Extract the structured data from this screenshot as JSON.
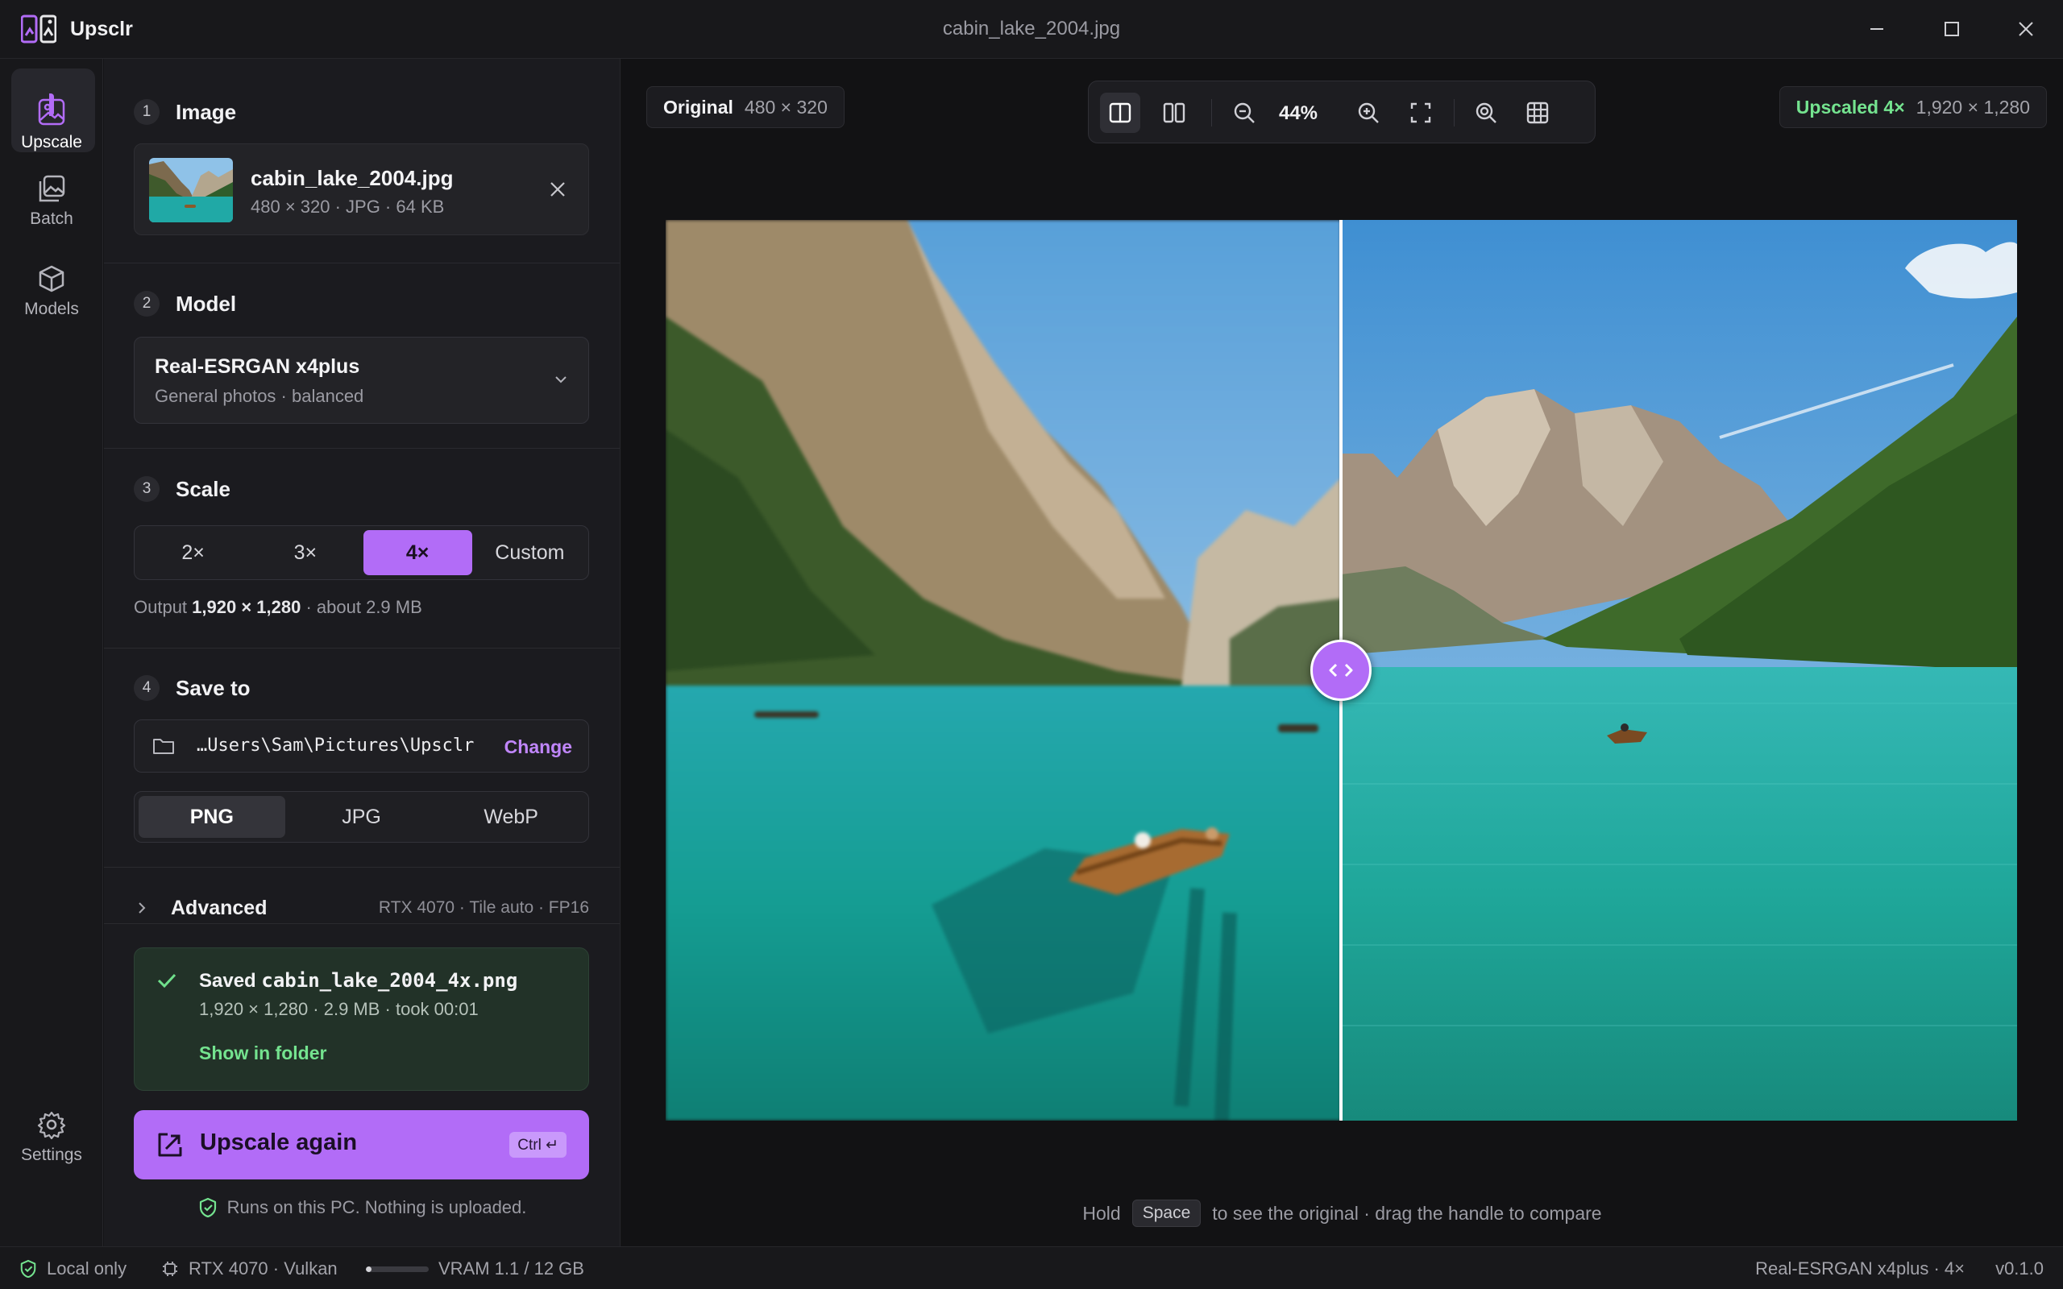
{
  "app": {
    "name": "Upsclr",
    "window_title": "cabin_lake_2004.jpg"
  },
  "rail": {
    "items": [
      {
        "label": "Upscale",
        "icon": "image-icon",
        "active": true
      },
      {
        "label": "Batch",
        "icon": "images-stack-icon",
        "active": false
      },
      {
        "label": "Models",
        "icon": "cube-icon",
        "active": false
      }
    ],
    "settings_label": "Settings"
  },
  "sections": {
    "image": {
      "num": "1",
      "title": "Image"
    },
    "model": {
      "num": "2",
      "title": "Model"
    },
    "scale": {
      "num": "3",
      "title": "Scale"
    },
    "save": {
      "num": "4",
      "title": "Save to"
    }
  },
  "file": {
    "name": "cabin_lake_2004.jpg",
    "meta": "480 × 320 · JPG · 64 KB"
  },
  "model": {
    "name": "Real-ESRGAN x4plus",
    "desc": "General photos · balanced"
  },
  "scale": {
    "options": [
      "2×",
      "3×",
      "4×",
      "Custom"
    ],
    "selected": "4×",
    "output_prefix": "Output",
    "output_dims": "1,920 × 1,280",
    "output_suffix": "· about 2.9 MB"
  },
  "save": {
    "path": "…Users\\Sam\\Pictures\\Upsclr",
    "change_label": "Change",
    "formats": [
      "PNG",
      "JPG",
      "WebP"
    ],
    "selected_format": "PNG"
  },
  "advanced": {
    "label": "Advanced",
    "info": "RTX 4070 · Tile auto · FP16"
  },
  "result": {
    "prefix": "Saved",
    "filename": "cabin_lake_2004_4x.png",
    "meta": "1,920 × 1,280 · 2.9 MB · took 00:01",
    "action": "Show in folder"
  },
  "cta": {
    "label": "Upscale again",
    "shortcut": "Ctrl ↵"
  },
  "privacy": "Runs on this PC. Nothing is uploaded.",
  "preview": {
    "original_label": "Original",
    "original_dims": "480 × 320",
    "upscaled_label": "Upscaled 4×",
    "upscaled_dims": "1,920 × 1,280",
    "zoom": "44%",
    "divider_position": 0.5,
    "hint_before": "Hold",
    "hint_key": "Space",
    "hint_after": "to see the original · drag the handle to compare"
  },
  "status": {
    "mode": "Local only",
    "gpu": "RTX 4070 · Vulkan",
    "vram": "VRAM 1.1 / 12 GB",
    "vram_fraction": 0.09,
    "model_scale": "Real-ESRGAN x4plus · 4×",
    "version": "v0.1.0"
  },
  "colors": {
    "accent": "#b26cf7",
    "success": "#74e38f",
    "background": "#141416"
  }
}
